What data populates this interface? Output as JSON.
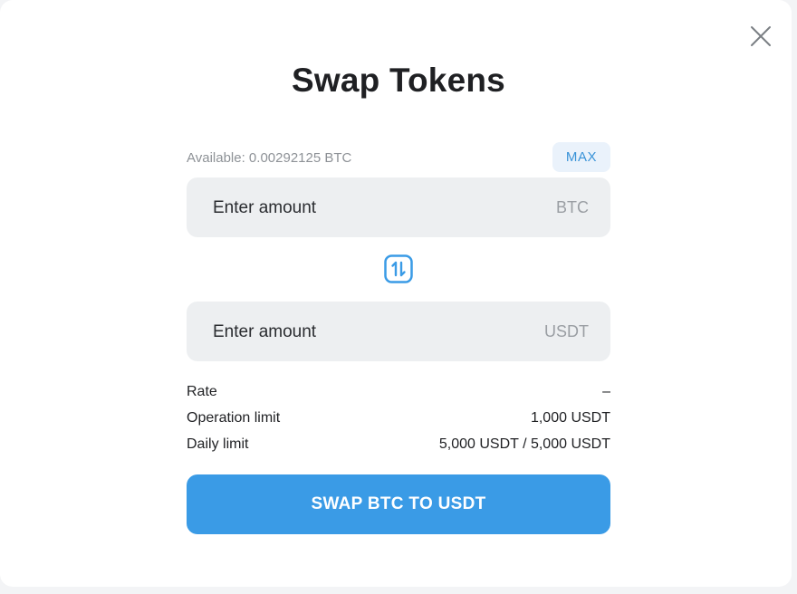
{
  "modal": {
    "title": "Swap Tokens",
    "close_icon": "close-icon"
  },
  "from": {
    "available_label": "Available: 0.00292125 BTC",
    "max_label": "MAX",
    "placeholder": "Enter amount",
    "unit": "BTC"
  },
  "swap_toggle_icon": "swap-direction-icon",
  "to": {
    "placeholder": "Enter amount",
    "unit": "USDT"
  },
  "info": {
    "rate_label": "Rate",
    "rate_value": "–",
    "operation_limit_label": "Operation limit",
    "operation_limit_value": "1,000 USDT",
    "daily_limit_label": "Daily limit",
    "daily_limit_value": "5,000 USDT / 5,000 USDT"
  },
  "submit_label": "SWAP BTC TO USDT",
  "colors": {
    "accent": "#3a9be6",
    "max_text": "#3a93d8",
    "max_bg": "#eaf2fb",
    "field_bg": "#edeff1"
  }
}
